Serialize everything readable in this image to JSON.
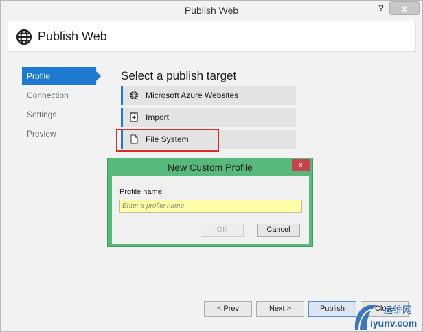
{
  "window": {
    "title": "Publish Web",
    "help_label": "?",
    "close_label": "x"
  },
  "header": {
    "title": "Publish Web",
    "icon": "globe-icon"
  },
  "nav": {
    "items": [
      {
        "label": "Profile",
        "active": true
      },
      {
        "label": "Connection",
        "active": false
      },
      {
        "label": "Settings",
        "active": false
      },
      {
        "label": "Preview",
        "active": false
      }
    ]
  },
  "main": {
    "section_title": "Select a publish target",
    "targets": [
      {
        "label": "Microsoft Azure Websites",
        "icon": "azure-icon"
      },
      {
        "label": "Import",
        "icon": "import-icon"
      },
      {
        "label": "File System",
        "icon": "file-icon",
        "highlighted": true
      }
    ]
  },
  "dialog": {
    "title": "New Custom Profile",
    "close_label": "x",
    "field_label": "Profile name:",
    "field_placeholder": "Enter a profile name",
    "field_value": "",
    "ok_label": "OK",
    "cancel_label": "Cancel"
  },
  "footer": {
    "prev_label": "< Prev",
    "next_label": "Next >",
    "publish_label": "Publish",
    "close_label": "Close"
  },
  "watermark": {
    "text": "iyunv.com",
    "cn_text": "运维网"
  },
  "colors": {
    "accent": "#1e7ad1",
    "dialog_frame": "#58b97c",
    "highlight_box": "#e0272a",
    "input_bg": "#ffffa8"
  }
}
